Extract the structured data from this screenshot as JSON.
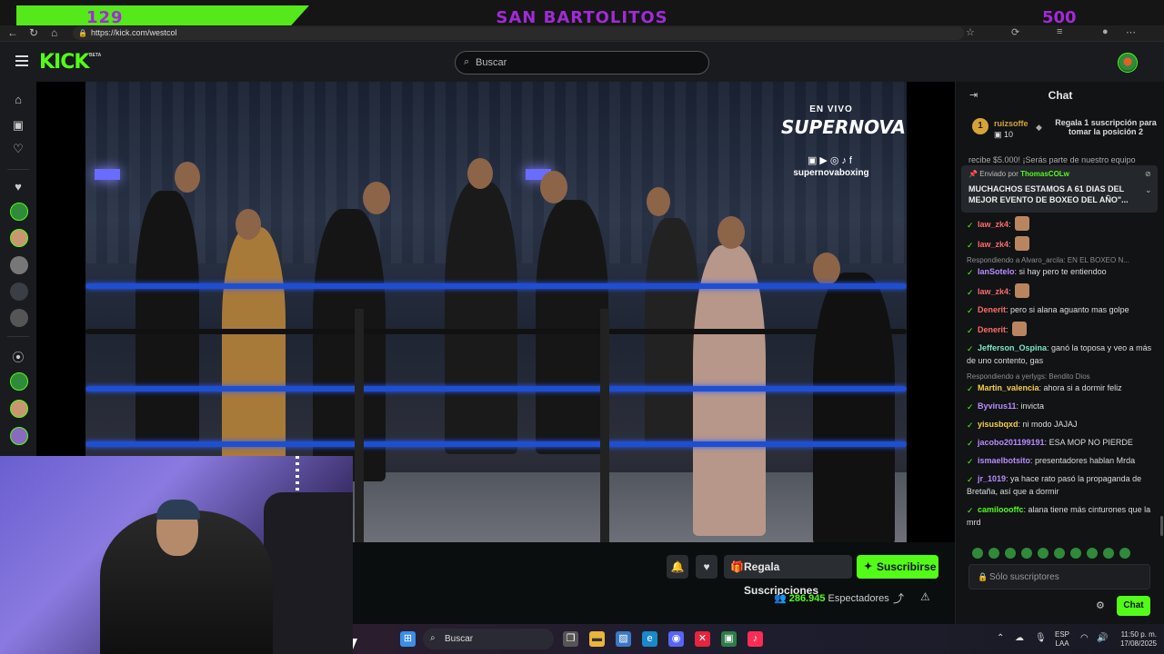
{
  "overlay": {
    "left_number": "129",
    "title": "SAN BARTOLITOS",
    "right_number": "500"
  },
  "browser": {
    "url": "https://kick.com/westcol"
  },
  "header": {
    "logo": "KICK",
    "beta": "BETA",
    "search_placeholder": "Buscar"
  },
  "stream_overlay": {
    "live_label": "EN VIVO",
    "brand": "SUPERNOVA",
    "handle": "supernovaboxing"
  },
  "player_actions": {
    "gift_label": "Regala Suscripciones",
    "subscribe_label": "Suscribirse",
    "viewers_count": "286.945",
    "viewers_label": "Espectadores"
  },
  "chat": {
    "title": "Chat",
    "gift_top": {
      "rank": "1",
      "user": "ruizsoffe",
      "count": "10",
      "text": "Regala 1 suscripción para tomar la posición 2"
    },
    "pin_hint": "recibe $5.000! ¡Serás parte de nuestro equipo",
    "pinned": {
      "sent_by": "Enviado por",
      "user": "ThomasCOLw",
      "message": "MUCHACHOS ESTAMOS A 61 DIAS DEL MEJOR EVENTO DE BOXEO DEL AÑO\"..."
    },
    "messages": [
      {
        "user": "law_zk4",
        "text": "",
        "color": "#ff6b6b",
        "emote": true
      },
      {
        "user": "law_zk4",
        "text": "",
        "color": "#ff6b6b",
        "emote": true
      },
      {
        "reply": "Respondiendo a Alvaro_arcila: EN EL BOXEO N...",
        "user": "IanSotelo",
        "text": "si hay pero te entiendoo",
        "color": "#b98cff"
      },
      {
        "user": "law_zk4",
        "text": "",
        "color": "#ff6b6b",
        "emote": true
      },
      {
        "user": "Denerit",
        "text": "pero si alana aguanto mas golpe",
        "color": "#ff6b6b"
      },
      {
        "user": "Denerit",
        "text": "",
        "color": "#ff6b6b",
        "emote": true
      },
      {
        "user": "Jefferson_Ospina",
        "text": "ganó la toposa y veo a más de uno contento, gas",
        "color": "#7ee8c8"
      },
      {
        "reply": "Respondiendo a yerlygs: Bendito Dios",
        "user": "Martin_valencia",
        "text": "ahora si a dormir feliz",
        "color": "#f6d04d"
      },
      {
        "user": "Byvirus11",
        "text": "invicta",
        "color": "#b98cff"
      },
      {
        "user": "yisusbqxd",
        "text": "ni modo JAJAJ",
        "color": "#f6d04d"
      },
      {
        "user": "jacobo201199191",
        "text": "ESA MOP NO PIERDE",
        "color": "#b98cff"
      },
      {
        "user": "ismaelbotsito",
        "text": "presentadores hablan Mrda",
        "color": "#b98cff"
      },
      {
        "user": "jr_1019",
        "text": "ya hace rato pasó la propaganda de Bretaña, así que a dormir",
        "color": "#b98cff"
      },
      {
        "user": "camiloooffc",
        "text": "alana tiene más cinturones que la mrd",
        "color": "#53fc18"
      }
    ],
    "input_placeholder": "Sólo suscriptores",
    "send_label": "Chat"
  },
  "taskbar": {
    "search_label": "Buscar",
    "lang_line1": "ESP",
    "lang_line2": "LAA",
    "time": "11:50 p. m.",
    "date": "17/08/2025"
  }
}
